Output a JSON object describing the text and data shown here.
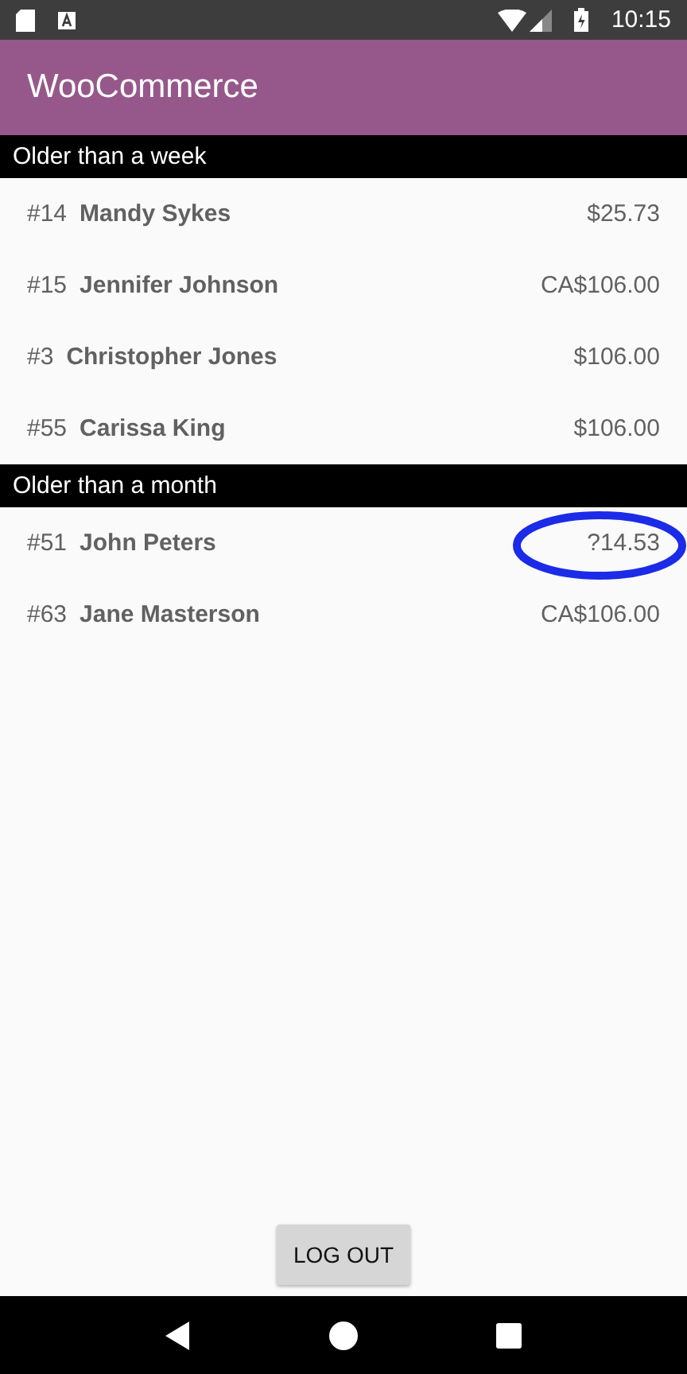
{
  "status_bar": {
    "time": "10:15"
  },
  "app_bar": {
    "title": "WooCommerce"
  },
  "sections": [
    {
      "title": "Older than a week",
      "orders": [
        {
          "number": "#14",
          "customer": "Mandy Sykes",
          "total": "$25.73",
          "circled": false
        },
        {
          "number": "#15",
          "customer": "Jennifer Johnson",
          "total": "CA$106.00",
          "circled": false
        },
        {
          "number": "#3",
          "customer": "Christopher Jones",
          "total": "$106.00",
          "circled": false
        },
        {
          "number": "#55",
          "customer": "Carissa King",
          "total": "$106.00",
          "circled": false
        }
      ]
    },
    {
      "title": "Older than a month",
      "orders": [
        {
          "number": "#51",
          "customer": "John Peters",
          "total": "?14.53",
          "circled": true
        },
        {
          "number": "#63",
          "customer": "Jane Masterson",
          "total": "CA$106.00",
          "circled": false
        }
      ]
    }
  ],
  "logout_button": "LOG OUT"
}
